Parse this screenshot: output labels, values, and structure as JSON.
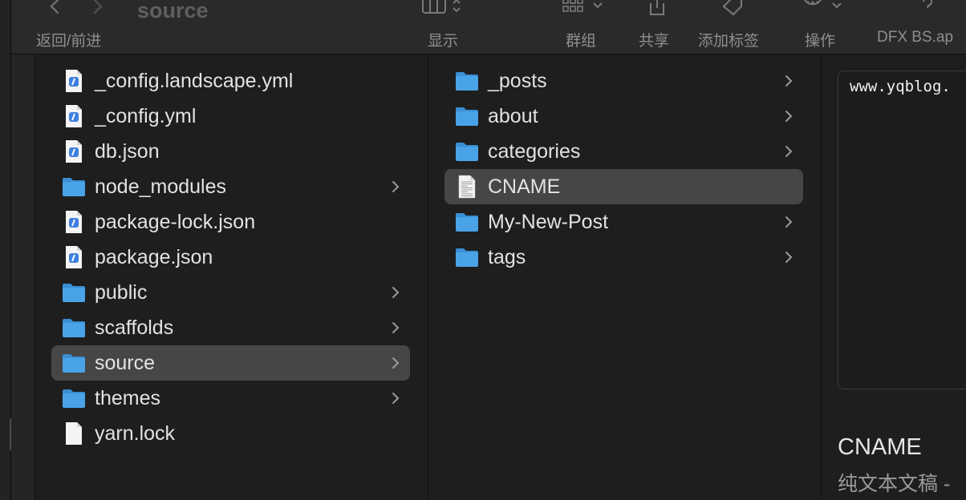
{
  "toolbar": {
    "title": "source",
    "back_forward_label": "返回/前进",
    "view_label": "显示",
    "group_label": "群组",
    "share_label": "共享",
    "tags_label": "添加标签",
    "action_label": "操作",
    "extension_label": "DFX BS.ap"
  },
  "column1": {
    "items": [
      {
        "name": "_config.landscape.yml",
        "kind": "file-doc",
        "folder": false
      },
      {
        "name": "_config.yml",
        "kind": "file-doc",
        "folder": false
      },
      {
        "name": "db.json",
        "kind": "file-doc",
        "folder": false
      },
      {
        "name": "node_modules",
        "kind": "folder",
        "folder": true
      },
      {
        "name": "package-lock.json",
        "kind": "file-doc",
        "folder": false
      },
      {
        "name": "package.json",
        "kind": "file-doc",
        "folder": false
      },
      {
        "name": "public",
        "kind": "folder",
        "folder": true
      },
      {
        "name": "scaffolds",
        "kind": "folder",
        "folder": true
      },
      {
        "name": "source",
        "kind": "folder",
        "folder": true,
        "selected": true
      },
      {
        "name": "themes",
        "kind": "folder",
        "folder": true
      },
      {
        "name": "yarn.lock",
        "kind": "file-plain",
        "folder": false
      }
    ]
  },
  "column2": {
    "items": [
      {
        "name": "_posts",
        "kind": "folder",
        "folder": true
      },
      {
        "name": "about",
        "kind": "folder",
        "folder": true
      },
      {
        "name": "categories",
        "kind": "folder",
        "folder": true
      },
      {
        "name": "CNAME",
        "kind": "file-text",
        "folder": false,
        "selected": true
      },
      {
        "name": "My-New-Post",
        "kind": "folder",
        "folder": true
      },
      {
        "name": "tags",
        "kind": "folder",
        "folder": true
      }
    ]
  },
  "preview": {
    "content": "www.yqblog.",
    "file_name": "CNAME",
    "kind_text": "纯文本文稿 -"
  },
  "colors": {
    "folder": "#4aa3e6",
    "folder_tab": "#3a8fd4",
    "selection": "#464646",
    "background": "#1e1e1e"
  }
}
